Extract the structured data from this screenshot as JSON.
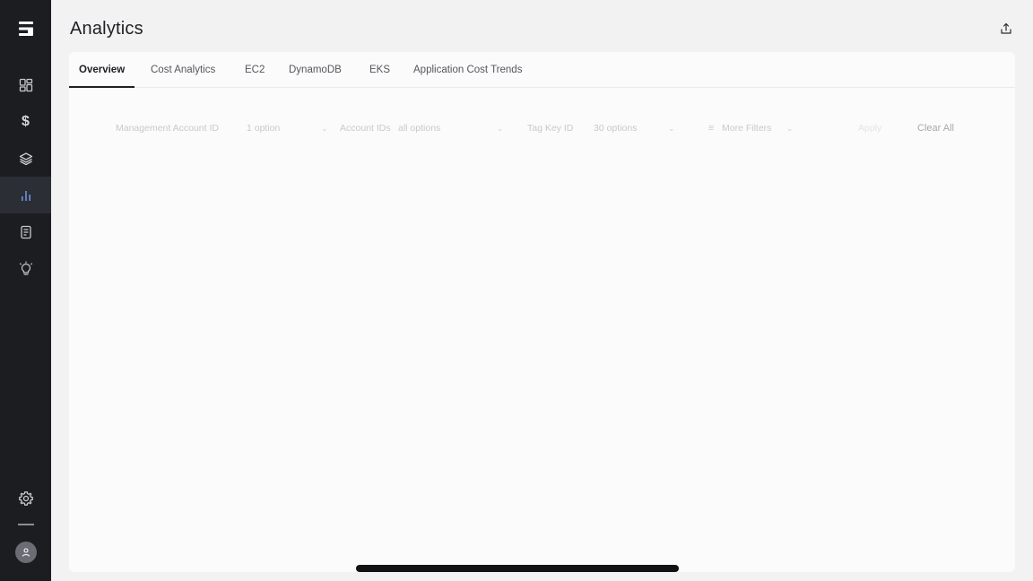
{
  "sidebar": {
    "logo": "logo-icon",
    "items": [
      {
        "name": "dashboard",
        "icon": "dashboard-icon"
      },
      {
        "name": "cost",
        "icon": "dollar-icon"
      },
      {
        "name": "resources",
        "icon": "layers-icon"
      },
      {
        "name": "analytics",
        "icon": "bar-chart-icon",
        "active": true
      },
      {
        "name": "reports",
        "icon": "document-icon"
      },
      {
        "name": "insights",
        "icon": "lightbulb-icon"
      }
    ],
    "bottom": [
      {
        "name": "settings",
        "icon": "gear-icon"
      },
      {
        "name": "profile",
        "icon": "user-avatar-icon"
      }
    ]
  },
  "header": {
    "title": "Analytics",
    "export_icon": "share-upload-icon"
  },
  "tabs": [
    {
      "label": "Overview",
      "active": true
    },
    {
      "label": "Cost Analytics"
    },
    {
      "label": "EC2"
    },
    {
      "label": "DynamoDB"
    },
    {
      "label": "EKS"
    },
    {
      "label": "Application Cost Trends"
    }
  ],
  "filters": {
    "managed_account_label": "Management Account ID",
    "managed_account_value": "1 option",
    "account_ids_label": "Account IDs",
    "account_ids_value": "all options",
    "tag_key_label": "Tag Key ID",
    "tag_key_value": "30 options",
    "more_filters": "More Filters",
    "apply": "Apply",
    "clear_all": "Clear All"
  },
  "colors": {
    "sidebar_bg": "#1c1d21",
    "active_nav_bg": "#2c2e35",
    "page_bg": "#f2f2f3",
    "card_bg": "#fbfbfc",
    "text_primary": "#1f2024"
  }
}
